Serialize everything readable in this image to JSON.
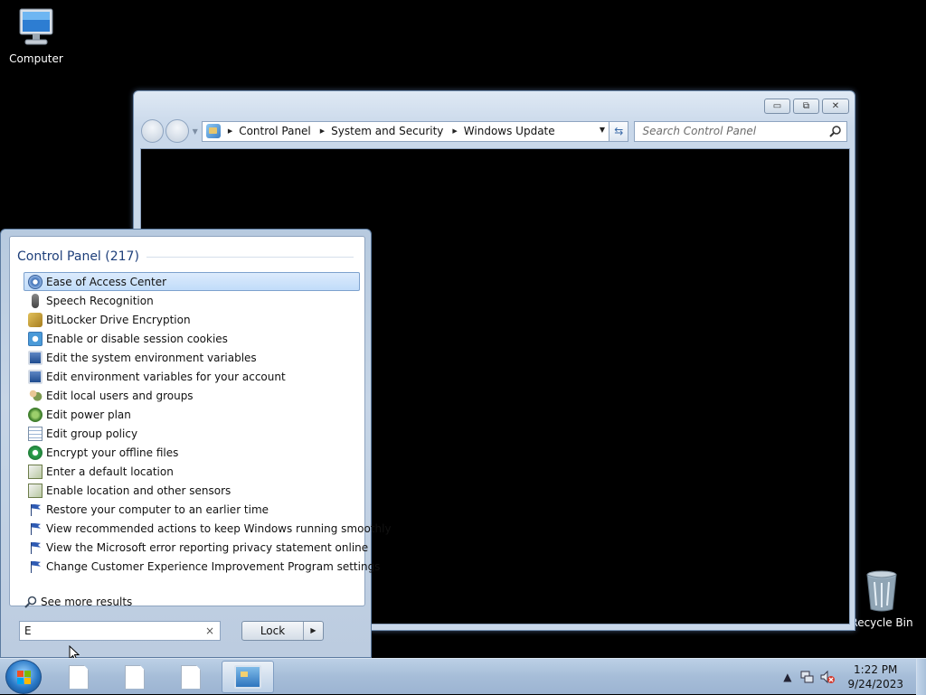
{
  "desktop": {
    "icons": [
      {
        "label": "Computer"
      },
      {
        "label": "Recycle Bin"
      }
    ]
  },
  "window": {
    "address": {
      "crumbs": [
        "Control Panel",
        "System and Security",
        "Windows Update"
      ]
    },
    "search_placeholder": "Search Control Panel"
  },
  "start_menu": {
    "section_title": "Control Panel (217)",
    "results": [
      {
        "label": "Ease of Access Center",
        "icon": "ease-of-access-icon"
      },
      {
        "label": "Speech Recognition",
        "icon": "microphone-icon"
      },
      {
        "label": "BitLocker Drive Encryption",
        "icon": "bitlocker-key-icon"
      },
      {
        "label": "Enable or disable session cookies",
        "icon": "internet-options-icon"
      },
      {
        "label": "Edit the system environment variables",
        "icon": "system-icon"
      },
      {
        "label": "Edit environment variables for your account",
        "icon": "system-icon"
      },
      {
        "label": "Edit local users and groups",
        "icon": "users-icon"
      },
      {
        "label": "Edit power plan",
        "icon": "power-icon"
      },
      {
        "label": "Edit group policy",
        "icon": "group-policy-icon"
      },
      {
        "label": "Encrypt your offline files",
        "icon": "sync-center-icon"
      },
      {
        "label": "Enter a default location",
        "icon": "location-icon"
      },
      {
        "label": "Enable location and other sensors",
        "icon": "location-icon"
      },
      {
        "label": "Restore your computer to an earlier time",
        "icon": "action-center-flag-icon"
      },
      {
        "label": "View recommended actions to keep Windows running smoothly",
        "icon": "action-center-flag-icon"
      },
      {
        "label": "View the Microsoft error reporting privacy statement online",
        "icon": "action-center-flag-icon"
      },
      {
        "label": "Change Customer Experience Improvement Program settings",
        "icon": "action-center-flag-icon"
      }
    ],
    "see_more": "See more results",
    "search_value": "E",
    "clear_glyph": "×",
    "lock_label": "Lock"
  },
  "taskbar": {
    "time": "1:22 PM",
    "date": "9/24/2023"
  }
}
